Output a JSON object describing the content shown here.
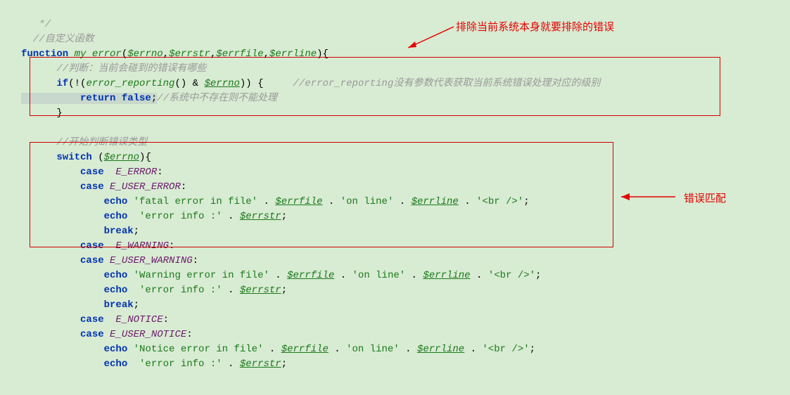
{
  "code": {
    "l1": "   */",
    "l2_prefix": "  //",
    "l2_comment": "自定义函数",
    "l3_kw1": "function ",
    "l3_fn": "my_error",
    "l3_open": "(",
    "l3_p1": "$errno",
    "l3_p2": "$errstr",
    "l3_p3": "$errfile",
    "l3_p4": "$errline",
    "l3_close": "){",
    "l4_comment": "      //判断：当前会碰到的错误有哪些",
    "l5_if": "      if",
    "l5_expr_open": "(!(",
    "l5_call": "error_reporting",
    "l5_mid": "() & ",
    "l5_var": "$errno",
    "l5_close": ")) {",
    "l5_comment": "     //error_reporting没有参数代表获取当前系统错误处理对应的级别",
    "l6_ret": "          return false",
    "l6_semi": ";",
    "l6_comment": "//系统中不存在则不能处理",
    "l7": "      }",
    "l8": " ",
    "l9_comment": "      //开始判断错误类型",
    "l10_sw": "      switch ",
    "l10_open": "(",
    "l10_var": "$errno",
    "l10_close": "){",
    "l11_case": "          case  ",
    "l11_const": "E_ERROR",
    "l11_colon": ":",
    "l12_case": "          case ",
    "l12_const": "E_USER_ERROR",
    "l12_colon": ":",
    "l13_echo": "              echo ",
    "l13_str1": "'fatal error in file' ",
    "l13_dot1": ". ",
    "l13_var1": "$errfile",
    "l13_dot2": " . ",
    "l13_str2": "'on line'",
    "l13_dot3": " . ",
    "l13_var2": "$errline",
    "l13_dot4": " . ",
    "l13_str3": "'<br />'",
    "l13_semi": ";",
    "l14_echo": "              echo  ",
    "l14_str1": "'error info :'",
    "l14_dot": " . ",
    "l14_var": "$errstr",
    "l14_semi": ";",
    "l15_break": "              break",
    "l15_semi": ";",
    "l16_case": "          case  ",
    "l16_const": "E_WARNING",
    "l16_colon": ":",
    "l17_case": "          case ",
    "l17_const": "E_USER_WARNING",
    "l17_colon": ":",
    "l18_echo": "              echo ",
    "l18_str1": "'Warning error in file' ",
    "l18_dot1": ". ",
    "l18_var1": "$errfile",
    "l18_dot2": " . ",
    "l18_str2": "'on line'",
    "l18_dot3": " . ",
    "l18_var2": "$errline",
    "l18_dot4": " . ",
    "l18_str3": "'<br />'",
    "l18_semi": ";",
    "l19_echo": "              echo  ",
    "l19_str1": "'error info :'",
    "l19_dot": " . ",
    "l19_var": "$errstr",
    "l19_semi": ";",
    "l20_break": "              break",
    "l20_semi": ";",
    "l21_case": "          case  ",
    "l21_const": "E_NOTICE",
    "l21_colon": ":",
    "l22_case": "          case ",
    "l22_const": "E_USER_NOTICE",
    "l22_colon": ":",
    "l23_echo": "              echo ",
    "l23_str1": "'Notice error in file' ",
    "l23_dot1": ". ",
    "l23_var1": "$errfile",
    "l23_dot2": " . ",
    "l23_str2": "'on line'",
    "l23_dot3": " . ",
    "l23_var2": "$errline",
    "l23_dot4": " . ",
    "l23_str3": "'<br />'",
    "l23_semi": ";",
    "l24_echo": "              echo  ",
    "l24_str1": "'error info :'",
    "l24_dot": " . ",
    "l24_var": "$errstr",
    "l24_semi": ";"
  },
  "annotations": {
    "a1": "排除当前系统本身就要排除的错误",
    "a2": "错误匹配"
  }
}
